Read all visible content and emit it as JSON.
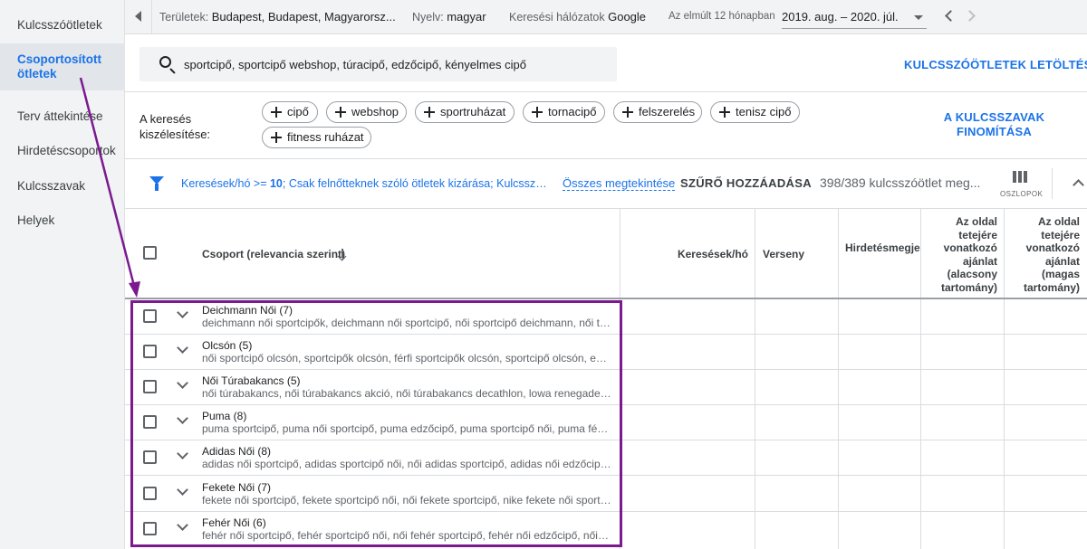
{
  "sidebar": {
    "items": [
      {
        "label": "Kulcsszóötletek",
        "active": false
      },
      {
        "label": "Csoportosított ötletek",
        "active": true
      },
      {
        "label": "Terv áttekintése",
        "active": false
      },
      {
        "label": "Hirdetéscsoportok",
        "active": false
      },
      {
        "label": "Kulcsszavak",
        "active": false
      },
      {
        "label": "Helyek",
        "active": false
      }
    ]
  },
  "topbar": {
    "territories_label": "Területek:",
    "territories_value": "Budapest, Budapest, Magyarorsz...",
    "language_label": "Nyelv:",
    "language_value": "magyar",
    "network_label": "Keresési hálózatok",
    "network_value": "Google",
    "period_label": "Az elmúlt 12 hónapban",
    "period_value": "2019. aug. – 2020. júl."
  },
  "search": {
    "value": "sportcipő, sportcipő webshop, túracipő, edzőcipő, kényelmes cipő"
  },
  "download_label": "KULCSSZÓÖTLETEK LETÖLTÉSE",
  "refine": {
    "label": "A keresés kiszélesítése:",
    "chips": [
      "cipő",
      "webshop",
      "sportruházat",
      "tornacipő",
      "felszerelés",
      "tenisz cipő",
      "fitness ruházat"
    ],
    "action_label": "A KULCSSZAVAK FINOMÍTÁSA"
  },
  "filters": {
    "f1_prefix": "Keresések/hó >= ",
    "f1_value": "10",
    "f2": ";  Csak felnőtteknek szóló ötletek kizárása;  Kulcsszó ...",
    "view_all": "Összes megtekintése",
    "add_filter": "SZŰRŐ HOZZÁADÁSA",
    "count": "398/389 kulcsszóötlet meg...",
    "columns_label": "OSZLOPOK"
  },
  "table": {
    "headers": {
      "group": "Csoport (relevancia szerint)",
      "searches": "Keresések/hó",
      "competition": "Verseny",
      "ad_share": "Hirdetésmegje",
      "bid_low": "Az oldal tetejére vonatkozó ajánlat (alacsony tartomány)",
      "bid_high": "Az oldal tetejére vonatkozó ajánlat (magas tartomány)"
    },
    "rows": [
      {
        "title": "Deichmann Női (7)",
        "keywords": "deichmann női sportcipők, deichmann női sportcipő, női sportcipő deichmann, női túracipő deichmann"
      },
      {
        "title": "Olcsón (5)",
        "keywords": "női sportcipő olcsón, sportcipők olcsón, férfi sportcipők olcsón, sportcipő olcsón, edzőcipő olcsón"
      },
      {
        "title": "Női Túrabakancs (5)",
        "keywords": "női túrabakancs, női túrabakancs akció, női túrabakancs decathlon, lowa renegade gtx női"
      },
      {
        "title": "Puma (8)",
        "keywords": "puma sportcipő, puma női sportcipő, puma edzőcipő, puma sportcipő női, puma férfi sportcipő"
      },
      {
        "title": "Adidas Női (8)",
        "keywords": "adidas női sportcipő, adidas sportcipő női, női adidas sportcipő, adidas női edzőcipő, adidas"
      },
      {
        "title": "Fekete Női (7)",
        "keywords": "fekete női sportcipő, fekete sportcipő női, női fekete sportcipő, nike fekete női sportcipő"
      },
      {
        "title": "Fehér Női (6)",
        "keywords": "fehér női sportcipő, fehér sportcipő női, női fehér sportcipő, fehér női edzőcipő, női fehér"
      }
    ]
  },
  "colors": {
    "accent": "#1a73e8",
    "annotation": "#7b1a8f"
  }
}
